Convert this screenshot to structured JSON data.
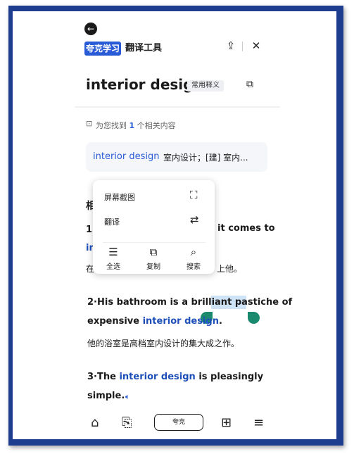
{
  "header": {
    "back_icon": "arrow-left-icon",
    "brand_badge": "夸克学习",
    "brand_tool": "翻译工具",
    "add_icon": "cloud-add-icon",
    "close_icon": "close-icon"
  },
  "entry": {
    "word": "interior design",
    "chip": "常用释义",
    "copy_icon": "copy-icon"
  },
  "result": {
    "found_prefix": "为您找到",
    "found_count": "1",
    "found_suffix": "个相关内容",
    "card_term": "interior design",
    "card_def": "室内设计；[建] 室内..."
  },
  "examples": {
    "section_head": "相",
    "ex1_num": "1",
    "ex1_tail": "it comes to",
    "ex1_line2_partial": "in",
    "ex1_cn_lead": "在",
    "ex1_cn_tail": "上他。",
    "ex2_line1_pre": "2·His bathroom is a brilliant ",
    "ex2_selected": "pastiche",
    "ex2_line1_post": " of",
    "ex2_line2_pre": "expensive ",
    "ex2_link": "interior design",
    "ex2_line2_post": ".",
    "ex2_cn": "他的浴室是高档室内设计的集大成之作。",
    "ex3_pre": "3·The ",
    "ex3_link": "interior design",
    "ex3_post": " is pleasingly",
    "ex3_line2": "simple."
  },
  "context_menu": {
    "screenshot_label": "屏幕截图",
    "translate_label": "翻译",
    "select_all_label": "全选",
    "copy_label": "复制",
    "search_label": "搜索"
  },
  "bottom_nav": {
    "center_label": "夸克"
  },
  "colors": {
    "frame": "#1e3d8f",
    "accent": "#2a5bd7",
    "selection": "#cfe3f6",
    "handle": "#1a8a6e"
  }
}
